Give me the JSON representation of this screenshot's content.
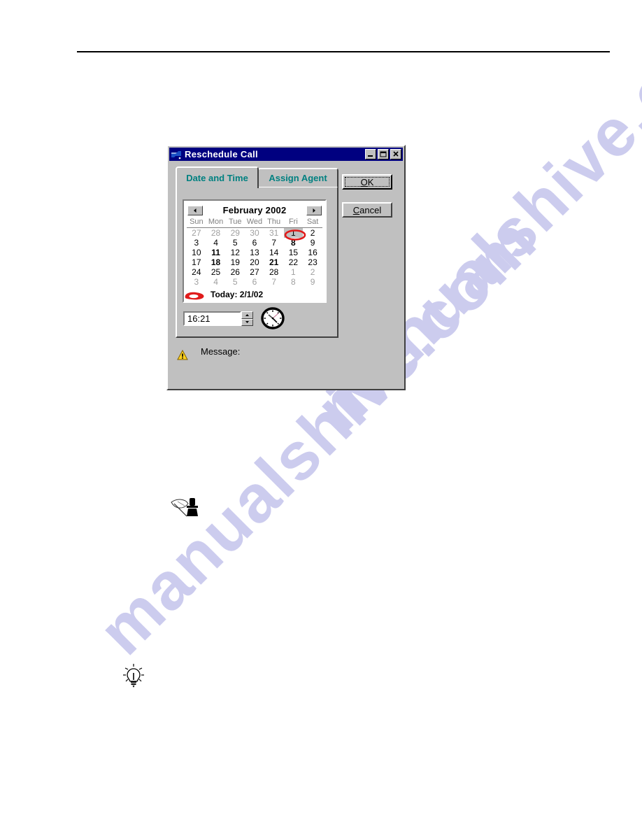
{
  "page": {
    "watermark_text": "manualshive.com"
  },
  "dialog": {
    "title": "Reschedule Call",
    "title_icon": "vb-app-icon",
    "titlebar_buttons": [
      {
        "name": "minimize",
        "glyph": "minimize-icon"
      },
      {
        "name": "maximize",
        "glyph": "maximize-icon"
      },
      {
        "name": "close",
        "glyph": "close-icon"
      }
    ],
    "tabs": [
      {
        "label": "Date and Time",
        "active": true
      },
      {
        "label": "Assign Agent",
        "active": false
      }
    ],
    "buttons": {
      "ok": {
        "accel": "O",
        "rest": "K"
      },
      "cancel": {
        "accel": "C",
        "rest": "ancel"
      }
    },
    "calendar": {
      "prev_label": "◄",
      "next_label": "►",
      "month_title": "February 2002",
      "weekdays": [
        "Sun",
        "Mon",
        "Tue",
        "Wed",
        "Thu",
        "Fri",
        "Sat"
      ],
      "weeks": [
        [
          {
            "d": "27",
            "state": "other"
          },
          {
            "d": "28",
            "state": "other"
          },
          {
            "d": "29",
            "state": "other"
          },
          {
            "d": "30",
            "state": "other"
          },
          {
            "d": "31",
            "state": "other"
          },
          {
            "d": "1",
            "state": "selected"
          },
          {
            "d": "2",
            "state": "normal"
          }
        ],
        [
          {
            "d": "3",
            "state": "normal"
          },
          {
            "d": "4",
            "state": "normal"
          },
          {
            "d": "5",
            "state": "normal"
          },
          {
            "d": "6",
            "state": "normal"
          },
          {
            "d": "7",
            "state": "normal"
          },
          {
            "d": "8",
            "state": "bold"
          },
          {
            "d": "9",
            "state": "normal"
          }
        ],
        [
          {
            "d": "10",
            "state": "normal"
          },
          {
            "d": "11",
            "state": "bold"
          },
          {
            "d": "12",
            "state": "normal"
          },
          {
            "d": "13",
            "state": "normal"
          },
          {
            "d": "14",
            "state": "normal"
          },
          {
            "d": "15",
            "state": "normal"
          },
          {
            "d": "16",
            "state": "normal"
          }
        ],
        [
          {
            "d": "17",
            "state": "normal"
          },
          {
            "d": "18",
            "state": "bold"
          },
          {
            "d": "19",
            "state": "normal"
          },
          {
            "d": "20",
            "state": "normal"
          },
          {
            "d": "21",
            "state": "bold"
          },
          {
            "d": "22",
            "state": "normal"
          },
          {
            "d": "23",
            "state": "normal"
          }
        ],
        [
          {
            "d": "24",
            "state": "normal"
          },
          {
            "d": "25",
            "state": "normal"
          },
          {
            "d": "26",
            "state": "normal"
          },
          {
            "d": "27",
            "state": "normal"
          },
          {
            "d": "28",
            "state": "normal"
          },
          {
            "d": "1",
            "state": "other"
          },
          {
            "d": "2",
            "state": "other"
          }
        ],
        [
          {
            "d": "3",
            "state": "other"
          },
          {
            "d": "4",
            "state": "other"
          },
          {
            "d": "5",
            "state": "other"
          },
          {
            "d": "6",
            "state": "other"
          },
          {
            "d": "7",
            "state": "other"
          },
          {
            "d": "8",
            "state": "other"
          },
          {
            "d": "9",
            "state": "other"
          }
        ]
      ],
      "today_text": "Today: 2/1/02"
    },
    "time": {
      "value": "16:21",
      "spin_up": "▲",
      "spin_down": "▼",
      "clock_icon": "analog-clock-icon"
    },
    "message": {
      "label": "Message:",
      "icon": "warning-triangle-icon"
    }
  },
  "annotations": [
    {
      "name": "red-circle-day-1",
      "shape": "ellipse",
      "color": "#e01b1b"
    },
    {
      "name": "red-circle-today",
      "shape": "ellipse-filled",
      "color": "#e01b1b"
    }
  ],
  "doc_icons": [
    {
      "name": "quill-and-inkwell-icon"
    },
    {
      "name": "lightbulb-tip-icon"
    }
  ],
  "colors": {
    "titlebar": "#000080",
    "face": "#c0c0c0",
    "tab_text": "#008080",
    "annotation_red": "#e01b1b",
    "watermark": "#ccccee"
  }
}
